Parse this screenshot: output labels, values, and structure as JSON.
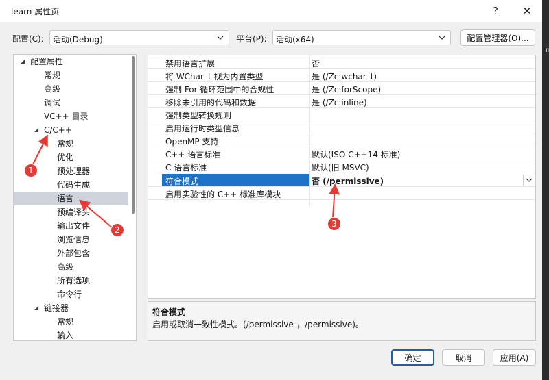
{
  "window": {
    "title": "learn 属性页",
    "help": "?",
    "close": "✕"
  },
  "config": {
    "label": "配置(C):",
    "value": "活动(Debug)"
  },
  "platform": {
    "label": "平台(P):",
    "value": "活动(x64)"
  },
  "config_manager_label": "配置管理器(O)...",
  "tree": {
    "items": [
      {
        "label": "配置属性",
        "expander": "◢"
      },
      {
        "label": "常规"
      },
      {
        "label": "高级"
      },
      {
        "label": "调试"
      },
      {
        "label": "VC++ 目录"
      },
      {
        "label": "C/C++",
        "expander": "◢"
      },
      {
        "label": "常规"
      },
      {
        "label": "优化"
      },
      {
        "label": "预处理器"
      },
      {
        "label": "代码生成"
      },
      {
        "label": "语言"
      },
      {
        "label": "预编译头"
      },
      {
        "label": "输出文件"
      },
      {
        "label": "浏览信息"
      },
      {
        "label": "外部包含"
      },
      {
        "label": "高级"
      },
      {
        "label": "所有选项"
      },
      {
        "label": "命令行"
      },
      {
        "label": "链接器",
        "expander": "◢"
      },
      {
        "label": "常规"
      },
      {
        "label": "输入"
      }
    ]
  },
  "properties": [
    {
      "name": "禁用语言扩展",
      "value": "否"
    },
    {
      "name": "将 WChar_t 视为内置类型",
      "value": "是 (/Zc:wchar_t)"
    },
    {
      "name": "强制 For 循环范围中的合规性",
      "value": "是 (/Zc:forScope)"
    },
    {
      "name": "移除未引用的代码和数据",
      "value": "是 (/Zc:inline)"
    },
    {
      "name": "强制类型转换规则",
      "value": ""
    },
    {
      "name": "启用运行时类型信息",
      "value": ""
    },
    {
      "name": "OpenMP 支持",
      "value": ""
    },
    {
      "name": "C++ 语言标准",
      "value": "默认(ISO C++14 标准)"
    },
    {
      "name": "C 语言标准",
      "value": "默认(旧 MSVC)"
    },
    {
      "name": "符合模式",
      "value": "否 (/permissive)"
    },
    {
      "name": "启用实验性的 C++ 标准库模块",
      "value": ""
    }
  ],
  "description": {
    "title": "符合模式",
    "text": "启用或取消一致性模式。(/permissive-，/permissive)。"
  },
  "buttons": {
    "ok": "确定",
    "cancel": "取消",
    "apply": "应用(A)"
  },
  "annotations": {
    "badge1": "1",
    "badge2": "2",
    "badge3": "3",
    "color": "#e53935"
  },
  "edge_glyph": "n"
}
